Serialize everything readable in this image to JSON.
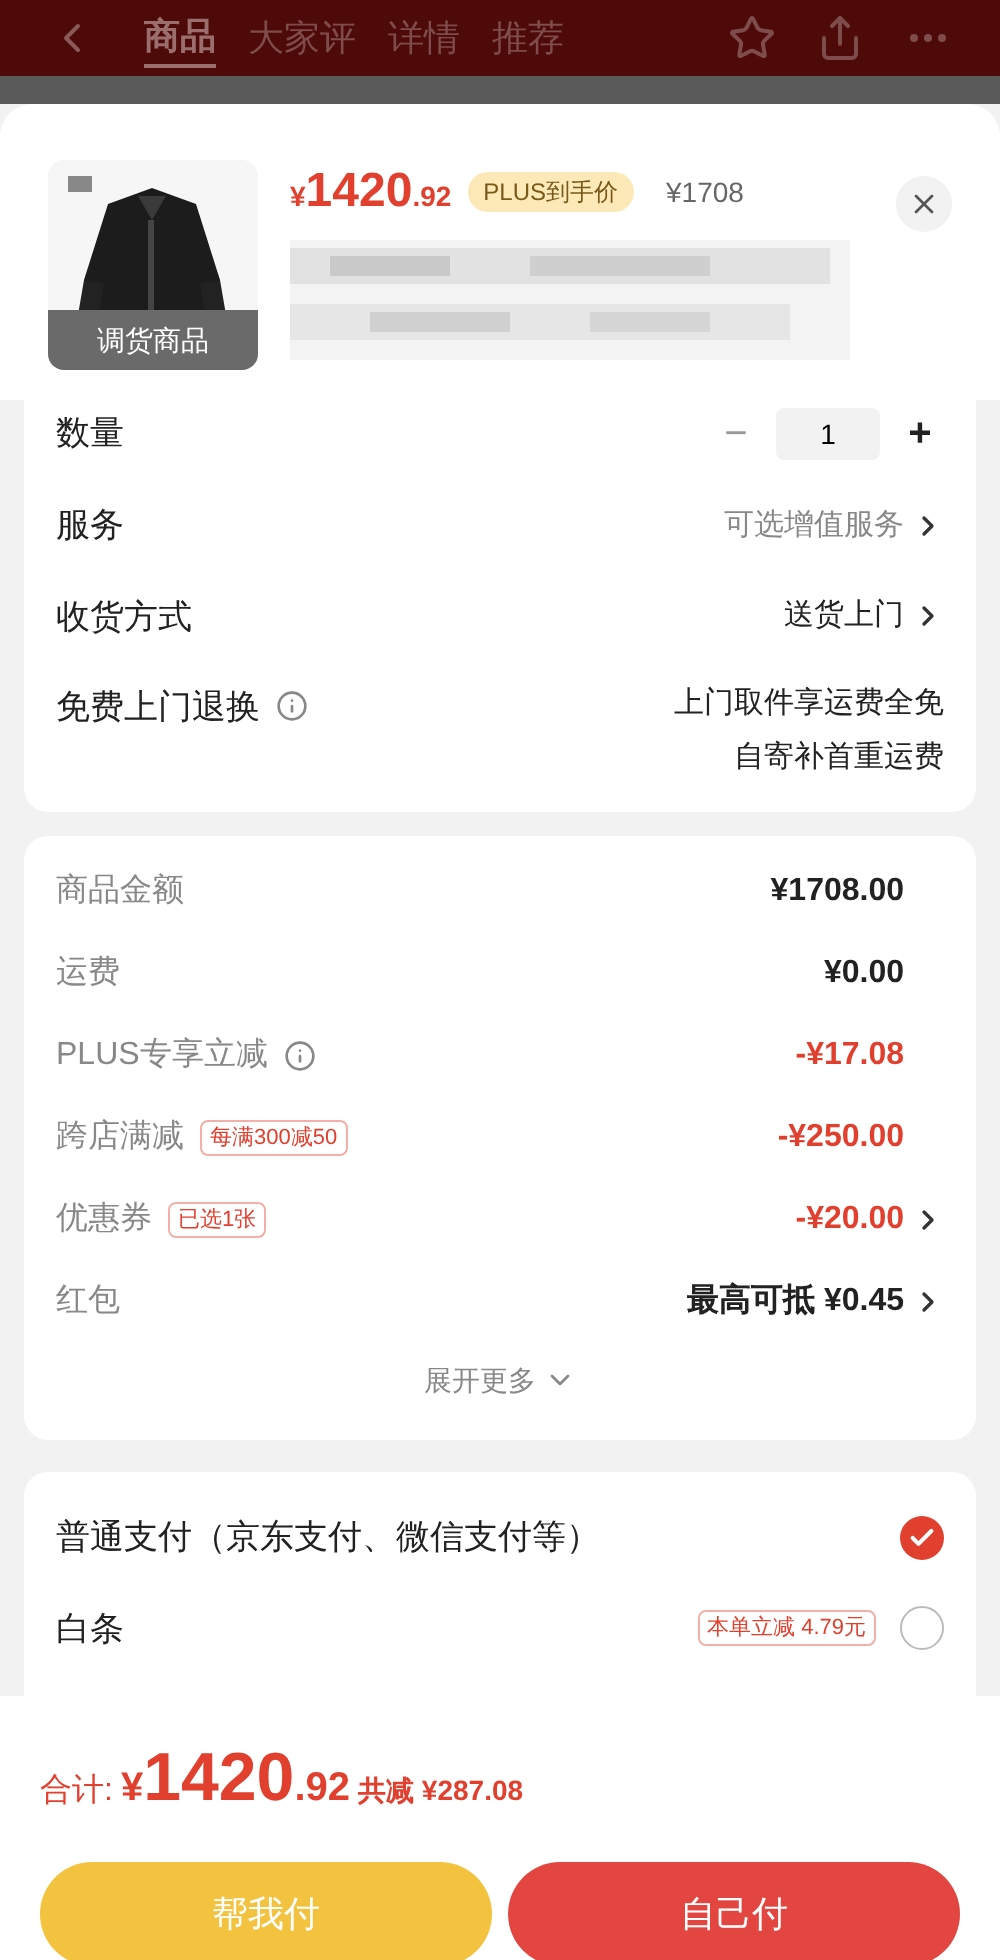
{
  "header": {
    "tabs": [
      {
        "label": "商品",
        "selected": true
      },
      {
        "label": "大家评",
        "selected": false
      },
      {
        "label": "详情",
        "selected": false
      },
      {
        "label": "推荐",
        "selected": false
      }
    ]
  },
  "product": {
    "badge": "调货商品",
    "currency": "¥",
    "price_int": "1420",
    "price_dec": ".92",
    "plus_tag": "PLUS到手价",
    "original_price": "¥1708"
  },
  "options": [
    {
      "kind": "quantity",
      "label": "数量",
      "minus": "−",
      "value": "1",
      "plus": "+"
    },
    {
      "kind": "link",
      "label": "服务",
      "value": "可选增值服务",
      "muted": true
    },
    {
      "kind": "link",
      "label": "收货方式",
      "value": "送货上门",
      "muted": false
    },
    {
      "kind": "info",
      "label": "免费上门退换",
      "lines": [
        "上门取件享运费全免",
        "自寄补首重运费"
      ]
    }
  ],
  "summary": {
    "rows": [
      {
        "label": "商品金额",
        "value": "¥1708.00",
        "discount": false,
        "info": false,
        "arrow": false
      },
      {
        "label": "运费",
        "value": "¥0.00",
        "discount": false,
        "info": false,
        "arrow": false
      },
      {
        "label": "PLUS专享立减",
        "value": "-¥17.08",
        "discount": true,
        "info": true,
        "arrow": false
      },
      {
        "label": "跨店满减",
        "tag": "每满300减50",
        "value": "-¥250.00",
        "discount": true,
        "info": false,
        "arrow": false
      },
      {
        "label": "优惠券",
        "tag": "已选1张",
        "value": "-¥20.00",
        "discount": true,
        "info": false,
        "arrow": true
      },
      {
        "label": "红包",
        "value": "最高可抵 ¥0.45",
        "discount": false,
        "info": false,
        "arrow": true
      }
    ],
    "expand": "展开更多"
  },
  "payments": [
    {
      "label": "普通支付（京东支付、微信支付等）",
      "selected": true
    },
    {
      "label": "白条",
      "tag": "本单立减 4.79元",
      "selected": false
    }
  ],
  "footer": {
    "total_label": "合计:",
    "currency": "¥",
    "price_int": "1420",
    "price_dec": ".92",
    "saved": "共减 ¥287.08",
    "buttons": [
      {
        "label": "帮我付",
        "kind": "secondary"
      },
      {
        "label": "自己付",
        "kind": "primary"
      }
    ]
  }
}
